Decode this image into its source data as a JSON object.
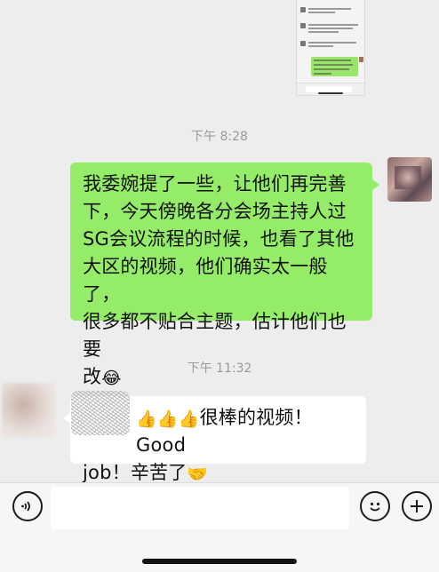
{
  "chat": {
    "timestamps": [
      "下午 8:28",
      "下午 11:32"
    ],
    "outgoing_message": {
      "lines": [
        "我委婉提了一些，让他们再完善",
        "下，今天傍晚各分会场主持人过",
        "SG会议流程的时候，也看了其他",
        "大区的视频，他们确实太一般了，",
        "很多都不贴合主题，估计他们也要",
        "改"
      ],
      "trailing_emoji": "😂"
    },
    "incoming_message": {
      "thumbs": "👍👍👍",
      "line1_text": "很棒的视频！Good",
      "line2_text": "job！辛苦了",
      "trailing_emoji": "🤝"
    }
  },
  "input_bar": {
    "voice_icon": "voice-icon",
    "emoji_icon": "smiley-icon",
    "plus_icon": "plus-icon",
    "input_value": ""
  },
  "colors": {
    "background": "#ededed",
    "outgoing_bubble": "#95ec69",
    "incoming_bubble": "#ffffff",
    "timestamp": "#9a9a9a"
  }
}
